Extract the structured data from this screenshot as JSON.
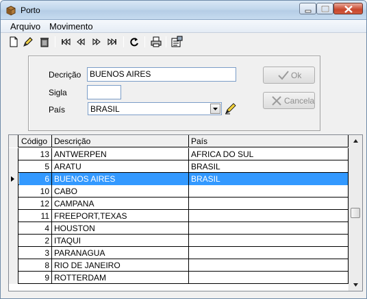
{
  "window": {
    "title": "Porto"
  },
  "menu": {
    "items": [
      "Arquivo",
      "Movimento"
    ]
  },
  "toolbar": {
    "icons": [
      "new-document-icon",
      "edit-icon",
      "delete-icon",
      "first-record-icon",
      "previous-record-icon",
      "next-record-icon",
      "last-record-icon",
      "refresh-icon",
      "print-icon",
      "properties-icon"
    ]
  },
  "form": {
    "descricao_label": "Decrição",
    "descricao_value": "BUENOS AIRES",
    "sigla_label": "Sigla",
    "sigla_value": "",
    "pais_label": "País",
    "pais_value": "BRASIL",
    "ok_label": "Ok",
    "cancel_label": "Cancela"
  },
  "grid": {
    "columns": [
      "Código",
      "Descrição",
      "País"
    ],
    "selected_index": 2,
    "rows": [
      {
        "codigo": "13",
        "descricao": "ANTWERPEN",
        "pais": "AFRICA DO SUL"
      },
      {
        "codigo": "5",
        "descricao": "ARATU",
        "pais": "BRASIL"
      },
      {
        "codigo": "6",
        "descricao": "BUENOS AIRES",
        "pais": "BRASIL"
      },
      {
        "codigo": "10",
        "descricao": "CABO",
        "pais": ""
      },
      {
        "codigo": "12",
        "descricao": "CAMPANA",
        "pais": ""
      },
      {
        "codigo": "11",
        "descricao": "FREEPORT,TEXAS",
        "pais": ""
      },
      {
        "codigo": "4",
        "descricao": "HOUSTON",
        "pais": ""
      },
      {
        "codigo": "2",
        "descricao": "ITAQUI",
        "pais": ""
      },
      {
        "codigo": "3",
        "descricao": "PARANAGUA",
        "pais": ""
      },
      {
        "codigo": "8",
        "descricao": "RIO DE JANEIRO",
        "pais": ""
      },
      {
        "codigo": "9",
        "descricao": "ROTTERDAM",
        "pais": ""
      }
    ]
  },
  "colors": {
    "selection": "#3399ff",
    "titlebar": "#c2d7ec"
  }
}
